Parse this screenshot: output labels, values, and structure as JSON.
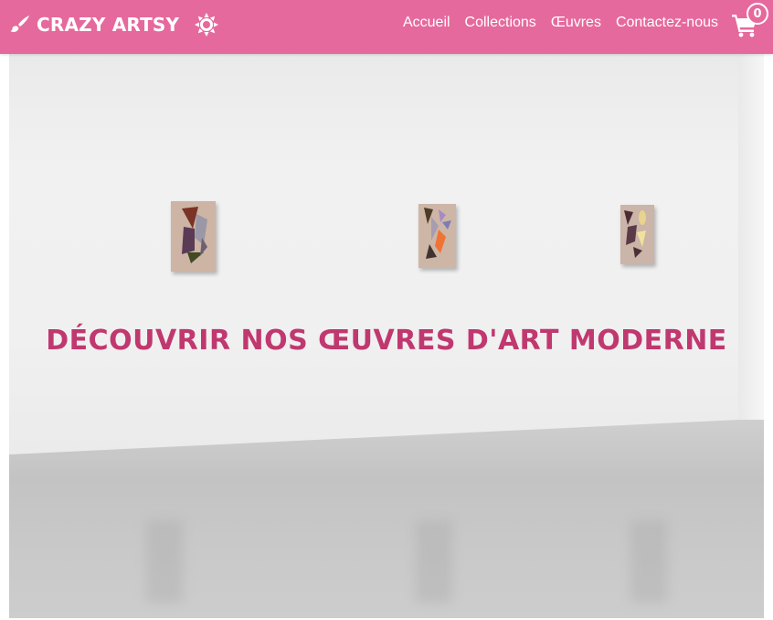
{
  "brand": {
    "name": "CRAZY ARTSY",
    "icon": "paintbrush-icon"
  },
  "theme_toggle": {
    "icon": "sun-icon"
  },
  "nav": {
    "links": [
      {
        "label": "Accueil"
      },
      {
        "label": "Collections"
      },
      {
        "label": "Œuvres"
      },
      {
        "label": "Contactez-nous"
      }
    ]
  },
  "cart": {
    "icon": "shopping-cart-icon",
    "count": "0"
  },
  "hero": {
    "title": "DÉCOUVRIR NOS ŒUVRES D'ART MODERNE",
    "image": "gallery-wall-with-three-paintings"
  },
  "colors": {
    "navbar": "#e6699d",
    "accent": "#c0386f",
    "text_on_nav": "#ffffff"
  }
}
